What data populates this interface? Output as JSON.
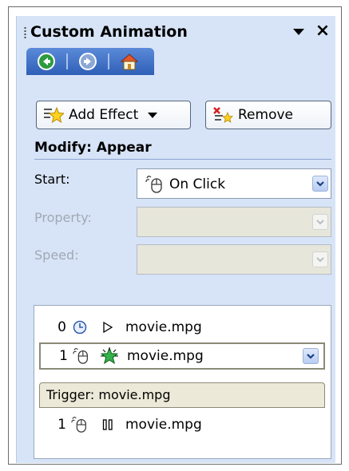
{
  "pane": {
    "title": "Custom Animation",
    "menu_icon": "dropdown-arrow-icon",
    "close_label": "×"
  },
  "nav": {
    "back_icon": "back-circle-icon",
    "forward_icon": "forward-circle-icon",
    "home_icon": "home-icon"
  },
  "buttons": {
    "add_effect": "Add Effect",
    "remove": "Remove"
  },
  "modify": {
    "title": "Modify: Appear",
    "start_label": "Start:",
    "start_value": "On Click",
    "property_label": "Property:",
    "property_value": "",
    "speed_label": "Speed:",
    "speed_value": ""
  },
  "animation_list": {
    "items": [
      {
        "order": "0",
        "timing_icon": "clock-icon",
        "effect_icon": "play-icon",
        "name": "movie.mpg"
      },
      {
        "order": "1",
        "timing_icon": "mouse-click-icon",
        "effect_icon": "appear-star-icon",
        "name": "movie.mpg",
        "selected": true
      }
    ],
    "trigger_label": "Trigger: movie.mpg",
    "trigger_items": [
      {
        "order": "1",
        "timing_icon": "mouse-click-icon",
        "effect_icon": "pause-icon",
        "name": "movie.mpg"
      }
    ]
  },
  "colors": {
    "pane_bg": "#d7e4f7",
    "nav_blue": "#2f5fb7",
    "trigger_bg": "#ece9d8"
  }
}
